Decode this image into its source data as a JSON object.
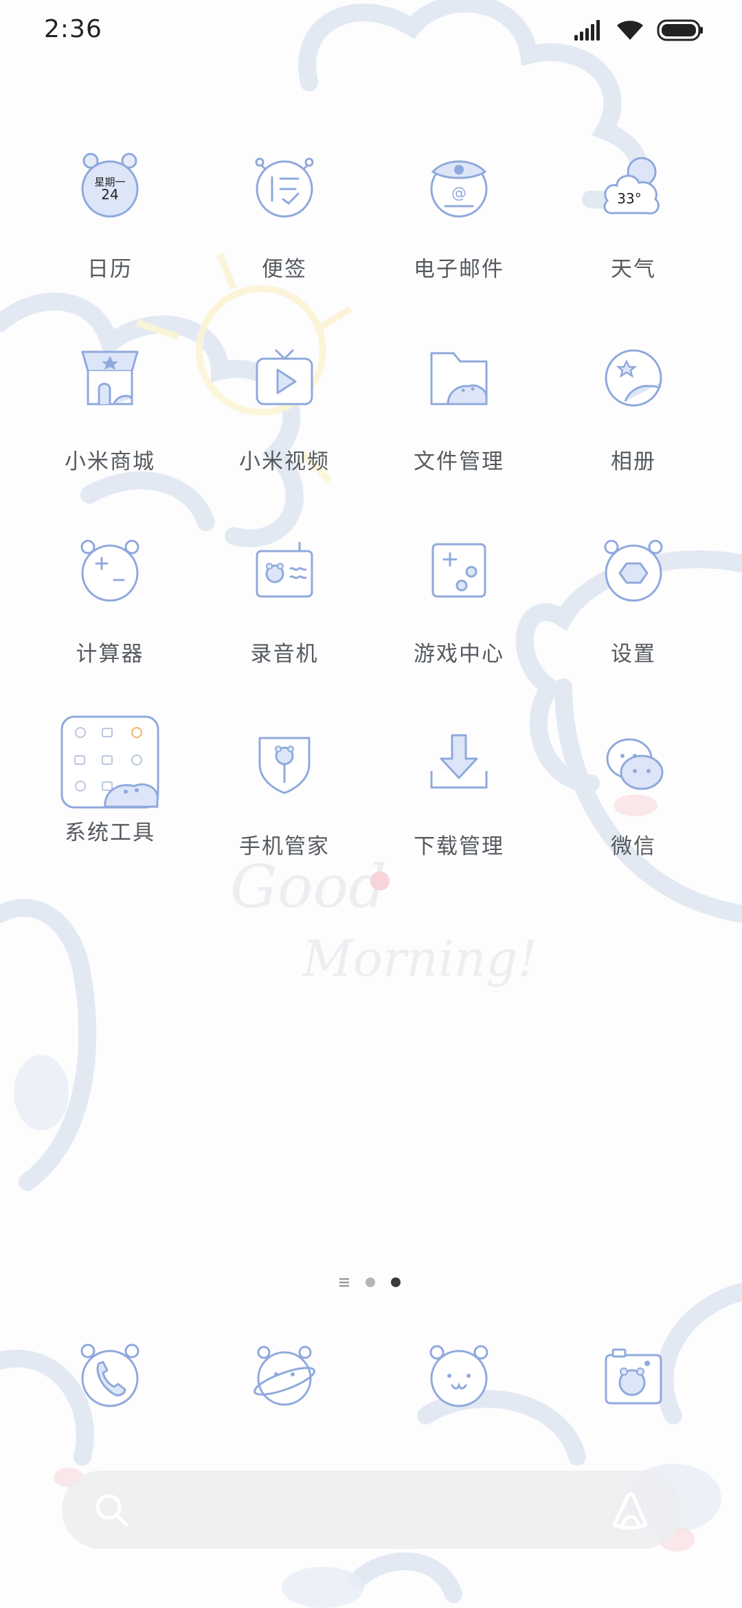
{
  "status_bar": {
    "time": "2:36",
    "icons": [
      "cellular-signal-icon",
      "wifi-icon",
      "battery-icon"
    ]
  },
  "apps": [
    {
      "label": "日历",
      "icon": "calendar-icon",
      "icon_text_top": "星期一",
      "icon_text_bottom": "24"
    },
    {
      "label": "便签",
      "icon": "notes-icon"
    },
    {
      "label": "电子邮件",
      "icon": "email-icon"
    },
    {
      "label": "天气",
      "icon": "weather-icon",
      "icon_text": "33°"
    },
    {
      "label": "小米商城",
      "icon": "mi-store-icon"
    },
    {
      "label": "小米视频",
      "icon": "mi-video-icon"
    },
    {
      "label": "文件管理",
      "icon": "file-manager-icon"
    },
    {
      "label": "相册",
      "icon": "gallery-icon"
    },
    {
      "label": "计算器",
      "icon": "calculator-icon"
    },
    {
      "label": "录音机",
      "icon": "recorder-icon"
    },
    {
      "label": "游戏中心",
      "icon": "game-center-icon"
    },
    {
      "label": "设置",
      "icon": "settings-icon"
    },
    {
      "label": "系统工具",
      "icon": "system-tools-folder-icon"
    },
    {
      "label": "手机管家",
      "icon": "security-icon"
    },
    {
      "label": "下载管理",
      "icon": "downloads-icon"
    },
    {
      "label": "微信",
      "icon": "wechat-icon"
    }
  ],
  "wallpaper_text": [
    "Good",
    "Morning!"
  ],
  "page_indicator": {
    "pages": 2,
    "current": 2,
    "has_list_page": true
  },
  "dock": [
    {
      "icon": "phone-icon"
    },
    {
      "icon": "browser-icon"
    },
    {
      "icon": "messages-icon"
    },
    {
      "icon": "camera-icon"
    }
  ],
  "search_bar": {
    "icons": [
      "search-icon",
      "assistant-icon"
    ]
  },
  "colors": {
    "icon_stroke": "#8fa9dc",
    "icon_fill": "#e4ecfa",
    "label": "#555a5f",
    "doodle": "#dfe6f2"
  }
}
